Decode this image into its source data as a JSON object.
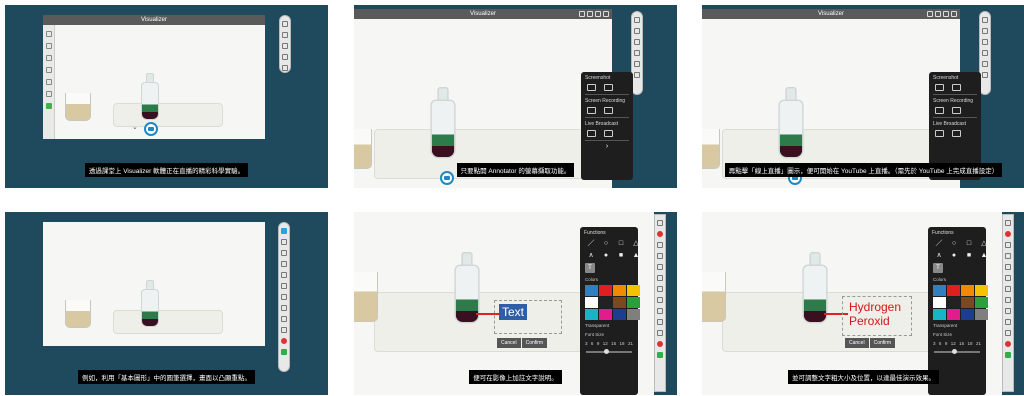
{
  "app": {
    "title": "Visualizer"
  },
  "subtitles": {
    "p1": "透過課堂上 Visualizer 軟體正在直播的精彩科學實驗。",
    "p2": "只要點開 Annotator 的螢幕擷取功能。",
    "p3": "再點擊「線上直播」圖示，便可開始在 YouTube 上直播。（需先於 YouTube 上完成直播設定）",
    "p4": "例如，利用「基本圖形」中的圓筆選擇，畫面以凸顯重點。",
    "p5": "便可在影像上加註文字說明。",
    "p6": "並可調整文字粗大小及位置，以達最佳演示效果。"
  },
  "capture_menu": {
    "screenshot": "Screenshot",
    "screen_recording": "Screen Recording",
    "live_broadcast": "Live Broadcast",
    "next": "›"
  },
  "functions_menu": {
    "title": "Functions",
    "shapes": [
      "／",
      "○",
      "□",
      "△",
      "∧",
      "●",
      "■",
      "▲"
    ],
    "text_tool": "T",
    "colors_label": "Colors",
    "colors": [
      "#2f7fc1",
      "#e02020",
      "#f08a00",
      "#f5c200",
      "#ffffff",
      "#222222",
      "#7a4a1e",
      "#2e9e3a",
      "#18b4c6",
      "#e01d8a",
      "#1e3d8f",
      "#7f7f7f"
    ],
    "transparent_label": "Transparent",
    "font_size_label": "Font Size",
    "font_sizes": [
      "3",
      "6",
      "9",
      "12",
      "15",
      "18",
      "21"
    ]
  },
  "annotations": {
    "text_label": "Text",
    "hydrogen_label_line1": "Hydrogen",
    "hydrogen_label_line2": "Peroxid",
    "cancel": "Cancel",
    "confirm": "Confirm"
  },
  "colors": {
    "accent": "#29a3d8",
    "record": "#d33333",
    "go": "#2fae4a",
    "panel_bg": "#1f4a5e"
  }
}
